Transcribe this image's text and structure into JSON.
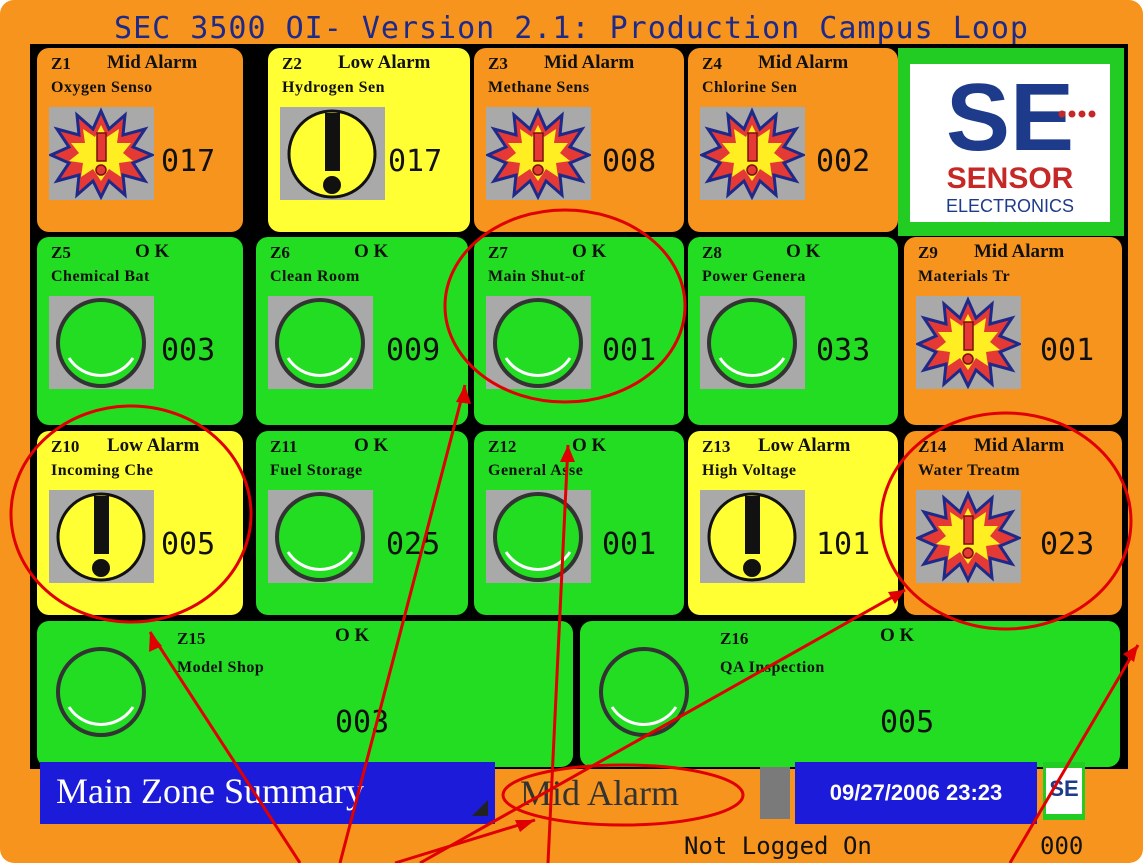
{
  "title": "SEC 3500 OI- Version 2.1: Production Campus Loop",
  "colors": {
    "frame": "#f7941d",
    "ok": "#22dd22",
    "low": "#ffff33",
    "mid": "#f7941d",
    "title": "#1e2a8a",
    "bar": "#1b1bd9",
    "annotation": "#e00000"
  },
  "zones": [
    {
      "id": "Z1",
      "status": "Mid Alarm",
      "name": "Oxygen Senso",
      "count": "017",
      "level": "mid",
      "icon": "explosion-alarm-icon"
    },
    {
      "id": "Z2",
      "status": "Low Alarm",
      "name": "Hydrogen Sen",
      "count": "017",
      "level": "low",
      "icon": "exclamation-icon"
    },
    {
      "id": "Z3",
      "status": "Mid Alarm",
      "name": "Methane Sens",
      "count": "008",
      "level": "mid",
      "icon": "explosion-alarm-icon"
    },
    {
      "id": "Z4",
      "status": "Mid Alarm",
      "name": "Chlorine Sen",
      "count": "002",
      "level": "mid",
      "icon": "explosion-alarm-icon"
    },
    {
      "id": "Z5",
      "status": "O K",
      "name": "Chemical Bat",
      "count": "003",
      "level": "ok",
      "icon": "green-circle-icon"
    },
    {
      "id": "Z6",
      "status": "O K",
      "name": "Clean Room",
      "count": "009",
      "level": "ok",
      "icon": "green-circle-icon"
    },
    {
      "id": "Z7",
      "status": "O K",
      "name": "Main Shut-of",
      "count": "001",
      "level": "ok",
      "icon": "green-circle-icon"
    },
    {
      "id": "Z8",
      "status": "O K",
      "name": "Power Genera",
      "count": "033",
      "level": "ok",
      "icon": "green-circle-icon"
    },
    {
      "id": "Z9",
      "status": "Mid Alarm",
      "name": "Materials Tr",
      "count": "001",
      "level": "mid",
      "icon": "explosion-alarm-icon"
    },
    {
      "id": "Z10",
      "status": "Low Alarm",
      "name": "Incoming Che",
      "count": "005",
      "level": "low",
      "icon": "exclamation-icon"
    },
    {
      "id": "Z11",
      "status": "O K",
      "name": "Fuel Storage",
      "count": "025",
      "level": "ok",
      "icon": "green-circle-icon"
    },
    {
      "id": "Z12",
      "status": "O K",
      "name": "General Asse",
      "count": "001",
      "level": "ok",
      "icon": "green-circle-icon"
    },
    {
      "id": "Z13",
      "status": "Low Alarm",
      "name": "High Voltage",
      "count": "101",
      "level": "low",
      "icon": "exclamation-icon"
    },
    {
      "id": "Z14",
      "status": "Mid Alarm",
      "name": "Water Treatm",
      "count": "023",
      "level": "mid",
      "icon": "explosion-alarm-icon"
    },
    {
      "id": "Z15",
      "status": "O K",
      "name": "Model Shop",
      "count": "003",
      "level": "ok",
      "icon": "green-circle-icon"
    },
    {
      "id": "Z16",
      "status": "O K",
      "name": "QA Inspection",
      "count": "005",
      "level": "ok",
      "icon": "green-circle-icon"
    }
  ],
  "logo": {
    "top": "SE",
    "mid": "SENSOR",
    "bottom": "ELECTRONICS"
  },
  "footer": {
    "screen_title": "Main Zone Summary",
    "alarm_state": "Mid Alarm",
    "datetime": "09/27/2006 23:23",
    "login_status": "Not Logged On",
    "counter": "000",
    "mini_logo": "SE"
  }
}
